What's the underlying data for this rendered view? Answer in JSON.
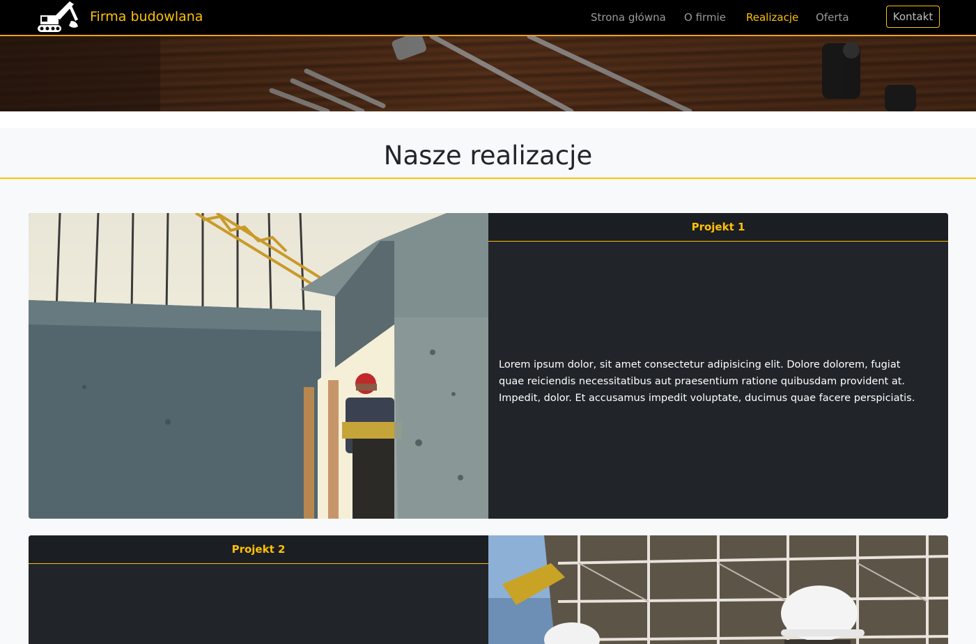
{
  "brand": {
    "name": "Firma budowlana",
    "logo_icon": "excavator-icon"
  },
  "nav": {
    "items": [
      {
        "label": "Strona główna",
        "active": false
      },
      {
        "label": "O firmie",
        "active": false
      },
      {
        "label": "Realizacje",
        "active": true
      },
      {
        "label": "Oferta",
        "active": false
      }
    ],
    "contact_label": "Kontakt"
  },
  "hero": {
    "image": "wood-tools-banner"
  },
  "section": {
    "title": "Nasze realizacje"
  },
  "projects": [
    {
      "title": "Projekt 1",
      "image": "construction-worker-concrete-photo",
      "text": "Lorem ipsum dolor, sit amet consectetur adipisicing elit. Dolore dolorem, fugiat quae reiciendis necessitatibus aut praesentium ratione quibusdam provident at. Impedit, dolor. Et accusamus impedit voluptate, ducimus quae facere perspiciatis."
    },
    {
      "title": "Projekt 2",
      "image": "scaffolding-workers-photo",
      "text": ""
    }
  ],
  "colors": {
    "accent": "#ffc107",
    "nav_bg": "#000000",
    "card_bg": "#212529",
    "page_bg": "#f8f9fa"
  }
}
